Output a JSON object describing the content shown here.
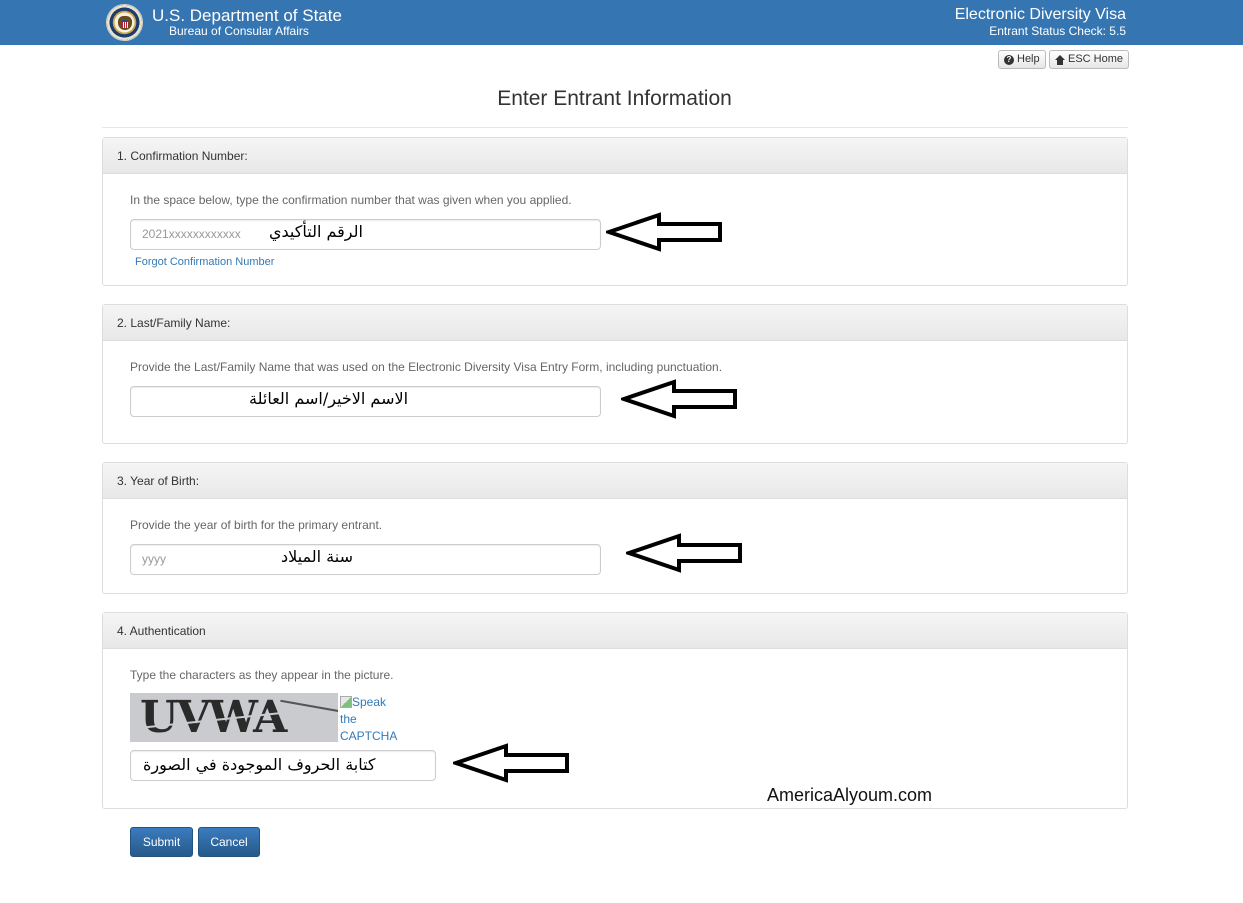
{
  "header": {
    "dept_title": "U.S. Department of State",
    "dept_subtitle": "Bureau of Consular Affairs",
    "app_title": "Electronic Diversity Visa",
    "app_subtitle": "Entrant Status Check: 5.5",
    "brand_color": "#3475b2"
  },
  "toolbar": {
    "help_label": "Help",
    "home_label": "ESC Home"
  },
  "page": {
    "title": "Enter Entrant Information"
  },
  "sections": [
    {
      "heading": "1. Confirmation Number:",
      "instruction": "In the space below, type the confirmation number that was given when you applied.",
      "field_placeholder": "2021xxxxxxxxxxxx",
      "annotation": "الرقم التأكيدي",
      "link": "Forgot Confirmation Number"
    },
    {
      "heading": "2. Last/Family Name:",
      "instruction": "Provide the Last/Family Name that was used on the Electronic Diversity Visa Entry Form, including punctuation.",
      "field_placeholder": "",
      "annotation": "الاسم الاخير/اسم العائلة"
    },
    {
      "heading": "3. Year of Birth:",
      "instruction": "Provide the year of birth for the primary entrant.",
      "field_placeholder": "yyyy",
      "annotation": "سنة الميلاد"
    },
    {
      "heading": "4. Authentication",
      "instruction": "Type the characters as they appear in the picture.",
      "captcha_text": "UVWA",
      "speak_alt": "Speak the CAPTCHA code",
      "field_placeholder": "",
      "annotation": "كتابة الحروف الموجودة في الصورة"
    }
  ],
  "watermark": "AmericaAlyoum.com",
  "actions": {
    "submit_label": "Submit",
    "cancel_label": "Cancel"
  }
}
